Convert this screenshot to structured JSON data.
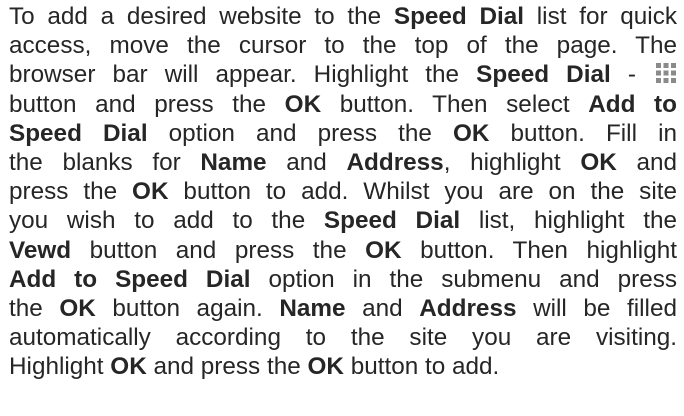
{
  "paragraph": {
    "l1": [
      "To add a desired website to the ",
      "Speed Dial",
      " list for quick"
    ],
    "l2": [
      "access, move the cursor to the top of the page. The"
    ],
    "l3": [
      "browser bar will appear. Highlight the ",
      "Speed Dial",
      " - "
    ],
    "l4": [
      "button and press the ",
      "OK",
      " button. Then select ",
      "Add to"
    ],
    "l5": [
      "Speed Dial",
      " option and press the ",
      "OK",
      " button. Fill in"
    ],
    "l6": [
      "the blanks for ",
      "Name",
      " and ",
      "Address",
      ", highlight ",
      "OK",
      " and"
    ],
    "l7": [
      "press the ",
      "OK",
      " button to add. Whilst you are on the site"
    ],
    "l8": [
      "you wish to add to the ",
      "Speed Dial",
      " list, highlight the"
    ],
    "l9": [
      "Vewd",
      " button and press the ",
      "OK",
      " button. Then highlight"
    ],
    "l10": [
      "Add to Speed Dial",
      " option in the submenu and press"
    ],
    "l11": [
      "the ",
      "OK",
      " button again. ",
      "Name",
      " and ",
      "Address",
      " will be filled"
    ],
    "l12": [
      "automatically according to the site you are visiting."
    ],
    "l13": [
      "Highlight ",
      "OK",
      " and press the ",
      "OK",
      " button to add."
    ]
  },
  "icons": {
    "speed_dial": "grid-icon"
  }
}
